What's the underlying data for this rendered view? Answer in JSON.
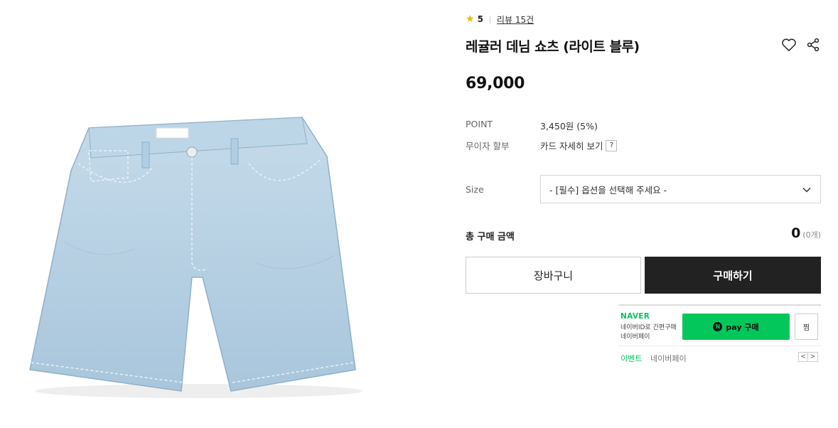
{
  "rating": {
    "score": "5",
    "review_link": "리뷰 15건"
  },
  "product": {
    "title": "레귤러 데님 쇼츠 (라이트 블루)",
    "price": "69,000",
    "image_tag": "DENIM"
  },
  "info": {
    "point_label": "POINT",
    "point_value": "3,450원 (5%)",
    "installment_label": "무이자 할부",
    "installment_value": "카드 자세히 보기",
    "help": "?"
  },
  "size": {
    "label": "Size",
    "placeholder": "- [필수] 옵션을 선택해 주세요 -"
  },
  "total": {
    "label": "총 구매 금액",
    "value": "0",
    "count": "(0개)"
  },
  "buttons": {
    "cart": "장바구니",
    "buy": "구매하기"
  },
  "naver": {
    "brand": "NAVER",
    "desc1": "네이버ID로 간편구매",
    "desc2": "네이버페이",
    "pay_n": "N",
    "pay_label": "pay 구매",
    "zzim": "찜",
    "event": "이벤트",
    "event_sub": "네이버페이",
    "prev": "<",
    "next": ">"
  },
  "colors": {
    "accent": "#222222",
    "naver_green": "#03c75a",
    "star": "#f5b700",
    "denim": "#b9d3e6"
  }
}
